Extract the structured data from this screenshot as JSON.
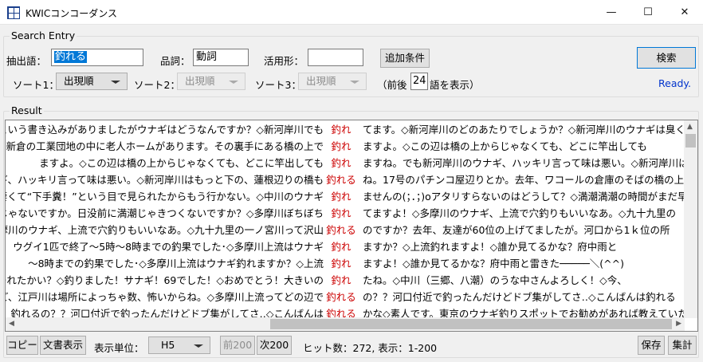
{
  "window": {
    "title": "KWICコンコーダンス",
    "controls": {
      "minimize": "—",
      "maximize": "☐",
      "close": "✕"
    }
  },
  "search": {
    "legend": "Search Entry",
    "extract_label": "抽出語：",
    "extract_value": "釣れる",
    "pos_label": "品詞：",
    "pos_value": "動詞",
    "conj_label": "活用形：",
    "conj_value": "",
    "add_condition": "追加条件",
    "search_button": "検索",
    "sort1_label": "ソート1：",
    "sort1_value": "出現順",
    "sort2_label": "ソート2：",
    "sort2_value": "出現順",
    "sort3_label": "ソート3：",
    "sort3_value": "出現順",
    "context_prefix": "（前後",
    "context_value": "24",
    "context_suffix": "語を表示）",
    "status": "Ready."
  },
  "result": {
    "legend": "Result",
    "rows": [
      {
        "left": "ぎ釣れないという書き込みがありましたがウナギはどうなんですか？◇新河岸川でも",
        "kw": "釣れ",
        "right": "てます。◇新河岸川のどのあたりでしょうか？◇新河岸川のウナギは臭くないですか？"
      },
      {
        "left": "光市新倉の工業団地の中に老人ホームがあります。その裏手にある橋の上で",
        "kw": "釣れ",
        "right": "ますよ。◇この辺は橋の上からじゃなくても、どこに竿出しても"
      },
      {
        "left": "ますよ。◇この辺は橋の上からじゃなくても、どこに竿出しても",
        "kw": "釣れ",
        "right": "ますね。でも新河岸川のウナギ、ハッキリ言って味は悪い。◇新河岸川はもっと下の、"
      },
      {
        "left": "岸ウナギ、ハッキリ言って味は悪い。◇新河岸川はもっと下の、蓮根辺りの橋も",
        "kw": "釣れる",
        "right": "ね。17号のパチンコ屋辺りとか。去年、ワコールの倉庫のそばの橋の上からやって"
      },
      {
        "left": "も凄くて“下手糞！”という目で見られたからもう行かない。◇中川のウナギ",
        "kw": "釣れ",
        "right": "ませんの(；．；)oアタリすらないのはどうして？◇満潮満潮の時間がまだ早いの"
      },
      {
        "left": "思いんじゃないですか。日没前に満潮じゃきつくないですか？◇多摩川ぼちぼち",
        "kw": "釣れ",
        "right": "てますよ！◇多摩川のウナギ、上流で穴釣りもいいなあ。◇九十九里の"
      },
      {
        "left": "多摩川のウナギ、上流で穴釣りもいいなあ。◇九十九里の一ノ宮川って沢山",
        "kw": "釣れる",
        "right": "のですか？去年、友達が60位の上げてましたが。河口から1ｋ位の所"
      },
      {
        "left": "ウグイ1匹で終了～5時～8時までの釣果でした･◇多摩川上流はウナギ",
        "kw": "釣れ",
        "right": "ますか？◇上流釣れますよ！◇誰か見てるかな？府中雨と"
      },
      {
        "left": "～8時までの釣果でした･◇多摩川上流はウナギ釣れますか？◇上流",
        "kw": "釣れ",
        "right": "ますよ！◇誰か見てるかな？府中雨と雷きた─────＼(^^)"
      },
      {
        "left": "つれたかい？◇釣りました！サナギ！69でした！◇おめでとう！大きいの",
        "kw": "釣れ",
        "right": "たね。◇中川（三郷、八潮）のうな中さんよろしく！◇今、"
      },
      {
        "left": "ただけど、江戸川は場所によっちゃ数、怖いからね。◇多摩川上流ってどの辺で",
        "kw": "釣れる",
        "right": "の？？河口付近で釣ったんだけどドブ集がしてさ‥◇こんばんは釣れる"
      },
      {
        "left": "釣れるの？？河口付近で釣ったんだけどドブ集がしてさ‥◇こんばんは",
        "kw": "釣れる",
        "right": "かな◇素人です。東京のウナギ釣りスポットでお勧めがあれば教えていただけますか"
      }
    ]
  },
  "footer": {
    "copy": "コピー",
    "doc_view": "文書表示",
    "unit_label": "表示単位：",
    "unit_value": "H5",
    "prev": "前200",
    "next": "次200",
    "hits": "ヒット数：272, 表示：1-200",
    "save": "保存",
    "aggregate": "集計"
  }
}
